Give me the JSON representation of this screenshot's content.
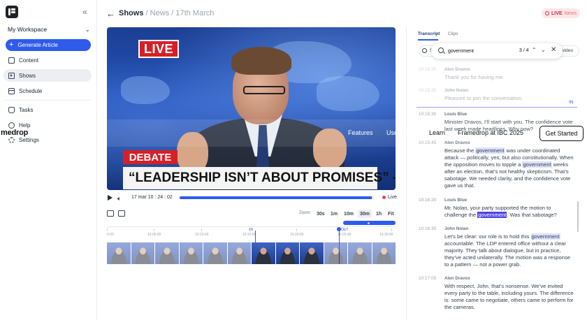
{
  "sidebar": {
    "workspace": "My Workspace",
    "generate_label": "Generate Article",
    "items": [
      {
        "label": "Content"
      },
      {
        "label": "Shows"
      },
      {
        "label": "Schedule"
      },
      {
        "label": "Tasks"
      },
      {
        "label": "Help"
      },
      {
        "label": "Settings"
      }
    ]
  },
  "header": {
    "section": "Shows",
    "crumb2": "News",
    "crumb3": "17th March",
    "live_label": "LIVE",
    "live_channel": "News",
    "sep": "/"
  },
  "video": {
    "live_tag": "LIVE",
    "debate_tag": "DEBATE",
    "headline": "“LEADERSHIP ISN’T ABOUT PROMISES” - PM"
  },
  "player": {
    "timecode": "17 mar 10 : 24 : 02",
    "progress": 0.99,
    "live_label": "Live"
  },
  "timeline": {
    "zoom_label": "Zoom:",
    "zoom_options": [
      "30s",
      "1m",
      "10m",
      "30m",
      "1h",
      "Fit"
    ],
    "zoom_selected": "30m",
    "ticks": [
      "0:00",
      "10:05:00",
      "10:10:00",
      "10:15:00",
      "10:20:00",
      "10:25:00",
      "10:30:00"
    ],
    "in_label": "IN",
    "out_label": "OUT"
  },
  "panel": {
    "tabs": [
      "Transcript",
      "Clips"
    ],
    "search_left": "S",
    "search_right": "video",
    "search_query": "government",
    "match_count": "3 / 4",
    "in_marker": "IN",
    "entries": [
      {
        "time": "10:15:20",
        "speaker": "Alen Dravos",
        "text": "Thank you for having me.",
        "faded": true
      },
      {
        "time": "10:15:25",
        "speaker": "John Nolan",
        "text": "Pleasure to join the conversation.",
        "faded": true
      },
      {
        "time": "10:15:30",
        "speaker": "Louis Blue",
        "text": "Minister Dravos, I’ll start with you. The confidence vote last week made headlines. Why now?",
        "faded": false
      },
      {
        "time": "10:15:45",
        "speaker": "Alen Dravos",
        "text": "Because the government was under coordinated attack — politically, yes, but also constitutionally. When the opposition moves to topple a government weeks after an election, that’s not healthy skepticism. That’s sabotage. We needed clarity, and the confidence vote gave us that.",
        "faded": false
      },
      {
        "time": "10:16:20",
        "speaker": "Louis Blue",
        "text": "Mr. Nolan, your party supported the motion to challenge the government. Was that sabotage?",
        "faded": false
      },
      {
        "time": "10:16:30",
        "speaker": "John Nolan",
        "text": "Let’s be clear: our role is to hold this government accountable. The LDP entered office without a clear majority. They talk about dialogue, but in practice, they’ve acted unilaterally. The motion was a response to a pattern — not a power grab.",
        "faded": false
      },
      {
        "time": "10:17:05",
        "speaker": "Alen Dravos",
        "text": "With respect, John, that’s nonsense. We’ve invited every party to the table, including yours. The difference is: some came to negotiate, others came to perform for the cameras.",
        "faded": false
      }
    ]
  },
  "overlay": {
    "brand": "medrop",
    "links": [
      "Features",
      "Use Cases",
      "Learn",
      "Framedrop at IBC 2025"
    ],
    "cta": "Get Started"
  },
  "colors": {
    "accent": "#2f5bea",
    "live_red": "#d62027",
    "highlight": "#dbe1fb",
    "current_highlight": "#4f46e5"
  }
}
